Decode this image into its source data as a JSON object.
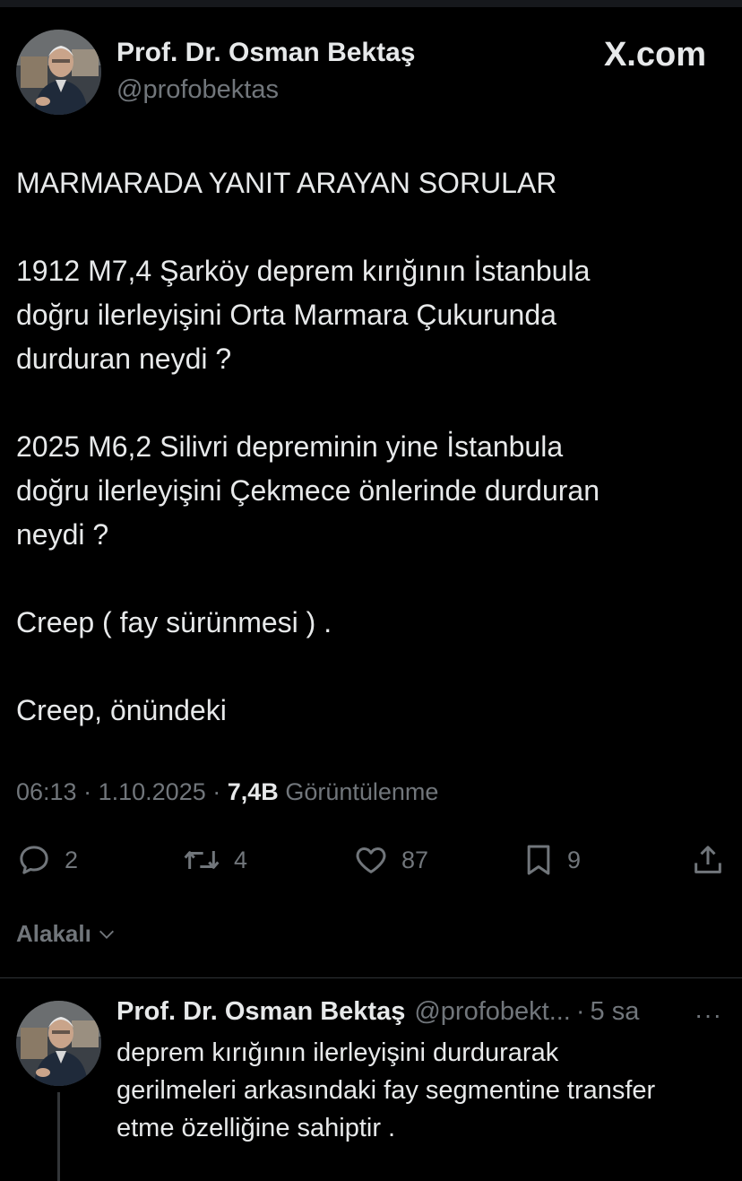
{
  "author": {
    "name": "Prof. Dr. Osman Bektaş",
    "handle": "@profobektas"
  },
  "brand": "X.com",
  "tweet": {
    "paragraphs": [
      [
        "MARMARADA YANIT ARAYAN SORULAR"
      ],
      [
        "1912 M7,4 Şarköy deprem kırığının İstanbula",
        "doğru ilerleyişini Orta Marmara Çukurunda",
        "durduran neydi ?"
      ],
      [
        "2025 M6,2 Silivri depreminin yine İstanbula",
        "doğru ilerleyişini Çekmece önlerinde durduran",
        "neydi ?"
      ],
      [
        "Creep ( fay sürünmesi ) ."
      ],
      [
        "Creep, önündeki"
      ]
    ]
  },
  "meta": {
    "time": "06:13",
    "date": "1.10.2025",
    "separator": "·",
    "views_count": "7,4B",
    "views_label": "Görüntülenme"
  },
  "actions": {
    "replies": "2",
    "reposts": "4",
    "likes": "87",
    "bookmarks": "9"
  },
  "related": {
    "label": "Alakalı"
  },
  "reply": {
    "name": "Prof. Dr. Osman Bektaş",
    "handle": "@profobekt...",
    "separator": "·",
    "time": "5 sa",
    "more": "···",
    "lines": [
      "deprem kırığının ilerleyişini durdurarak",
      "gerilmeleri arkasındaki fay segmentine transfer",
      "etme özelliğine sahiptir ."
    ]
  },
  "colors": {
    "background": "#000000",
    "text": "#e7e9ea",
    "secondary": "#71767b",
    "divider": "#2f3336"
  }
}
